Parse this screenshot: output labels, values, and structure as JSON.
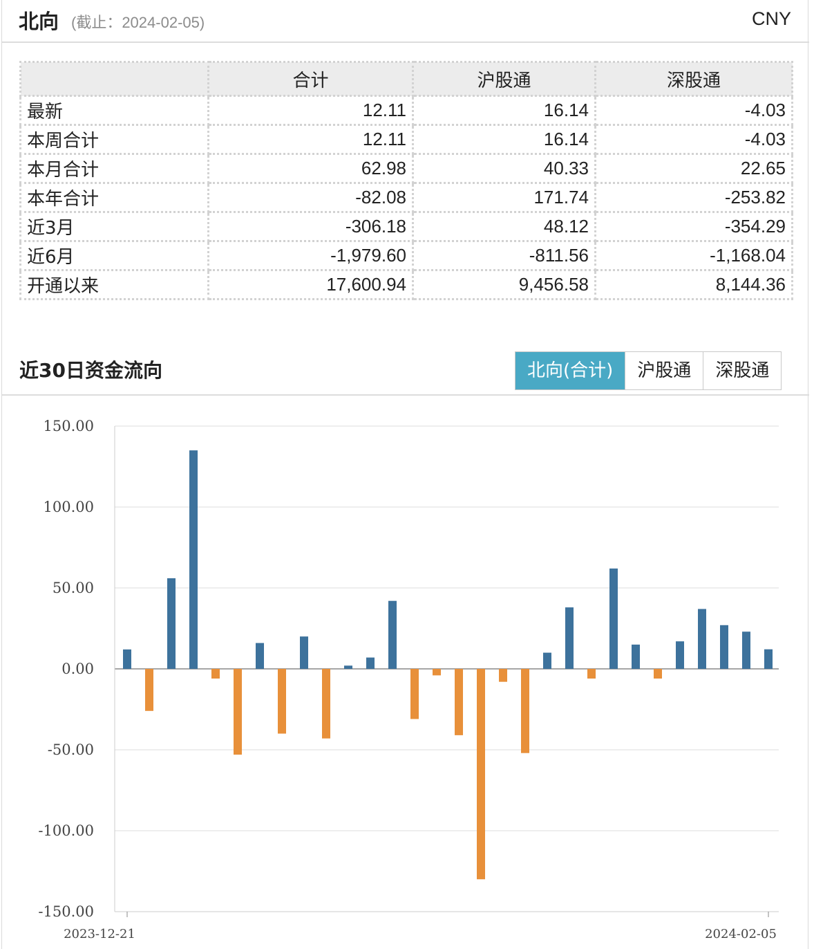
{
  "header": {
    "title": "北向",
    "date_note": "(截止：2024-02-05)",
    "currency": "CNY"
  },
  "summary_table": {
    "columns": [
      "",
      "合计",
      "沪股通",
      "深股通"
    ],
    "rows": [
      {
        "label": "最新",
        "total": "12.11",
        "sh": "16.14",
        "sz": "-4.03"
      },
      {
        "label": "本周合计",
        "total": "12.11",
        "sh": "16.14",
        "sz": "-4.03"
      },
      {
        "label": "本月合计",
        "total": "62.98",
        "sh": "40.33",
        "sz": "22.65"
      },
      {
        "label": "本年合计",
        "total": "-82.08",
        "sh": "171.74",
        "sz": "-253.82"
      },
      {
        "label": "近3月",
        "total": "-306.18",
        "sh": "48.12",
        "sz": "-354.29"
      },
      {
        "label": "近6月",
        "total": "-1,979.60",
        "sh": "-811.56",
        "sz": "-1,168.04"
      },
      {
        "label": "开通以来",
        "total": "17,600.94",
        "sh": "9,456.58",
        "sz": "8,144.36"
      }
    ]
  },
  "flow_section": {
    "title": "近30日资金流向",
    "tabs": [
      {
        "label": "北向(合计)",
        "active": true
      },
      {
        "label": "沪股通",
        "active": false
      },
      {
        "label": "深股通",
        "active": false
      }
    ]
  },
  "chart_data": {
    "type": "bar",
    "title": "",
    "xlabel": "",
    "ylabel": "",
    "ylim": [
      -150,
      150
    ],
    "yticks": [
      "150.00",
      "100.00",
      "50.00",
      "0.00",
      "-50.00",
      "-100.00",
      "-150.00"
    ],
    "x_tick_labels": [
      "2023-12-21",
      "2024-02-05"
    ],
    "positive_color": "#3d729c",
    "negative_color": "#e8903a",
    "grid": true,
    "values": [
      12,
      -26,
      56,
      135,
      -6,
      -53,
      16,
      -40,
      20,
      -43,
      2,
      7,
      42,
      -31,
      -4,
      -41,
      -130,
      -8,
      -52,
      10,
      38,
      -6,
      62,
      15,
      -6,
      17,
      37,
      27,
      23,
      12.11
    ]
  }
}
